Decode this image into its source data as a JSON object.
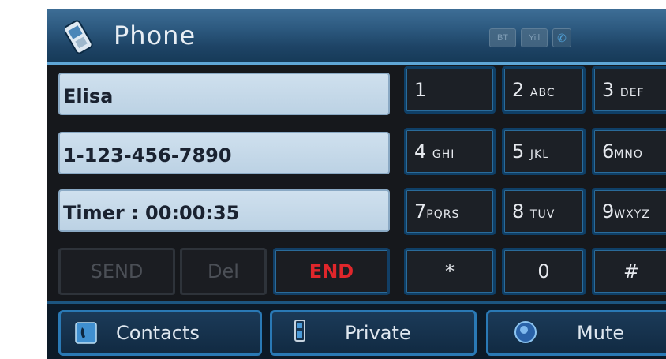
{
  "header": {
    "title": "Phone",
    "icons": [
      "bluetooth-status-icon",
      "signal-strength-icon",
      "call-status-icon"
    ],
    "status_label_1": "BT",
    "status_label_2": "Yill"
  },
  "call_info": {
    "name": "Elisa",
    "number": "1-123-456-7890",
    "timer": "Timer : 00:00:35"
  },
  "keypad": [
    {
      "digit": "1",
      "letters": ""
    },
    {
      "digit": "2",
      "letters": "ABC"
    },
    {
      "digit": "3",
      "letters": "DEF"
    },
    {
      "digit": "4",
      "letters": "GHI"
    },
    {
      "digit": "5",
      "letters": "JKL"
    },
    {
      "digit": "6",
      "letters": "MNO"
    },
    {
      "digit": "7",
      "letters": "PQRS"
    },
    {
      "digit": "8",
      "letters": "TUV"
    },
    {
      "digit": "9",
      "letters": "WXYZ"
    },
    {
      "digit": "*",
      "letters": ""
    },
    {
      "digit": "0",
      "letters": ""
    },
    {
      "digit": "#",
      "letters": ""
    }
  ],
  "controls": {
    "send": "SEND",
    "del": "Del",
    "end": "END",
    "end_color": "#e0262b"
  },
  "bottom_bar": {
    "contacts": "Contacts",
    "private": "Private",
    "mute": "Mute"
  },
  "colors": {
    "accent_border": "#2a79b5",
    "header": "#2d5a80",
    "field_bg": "#cfe0ee"
  }
}
